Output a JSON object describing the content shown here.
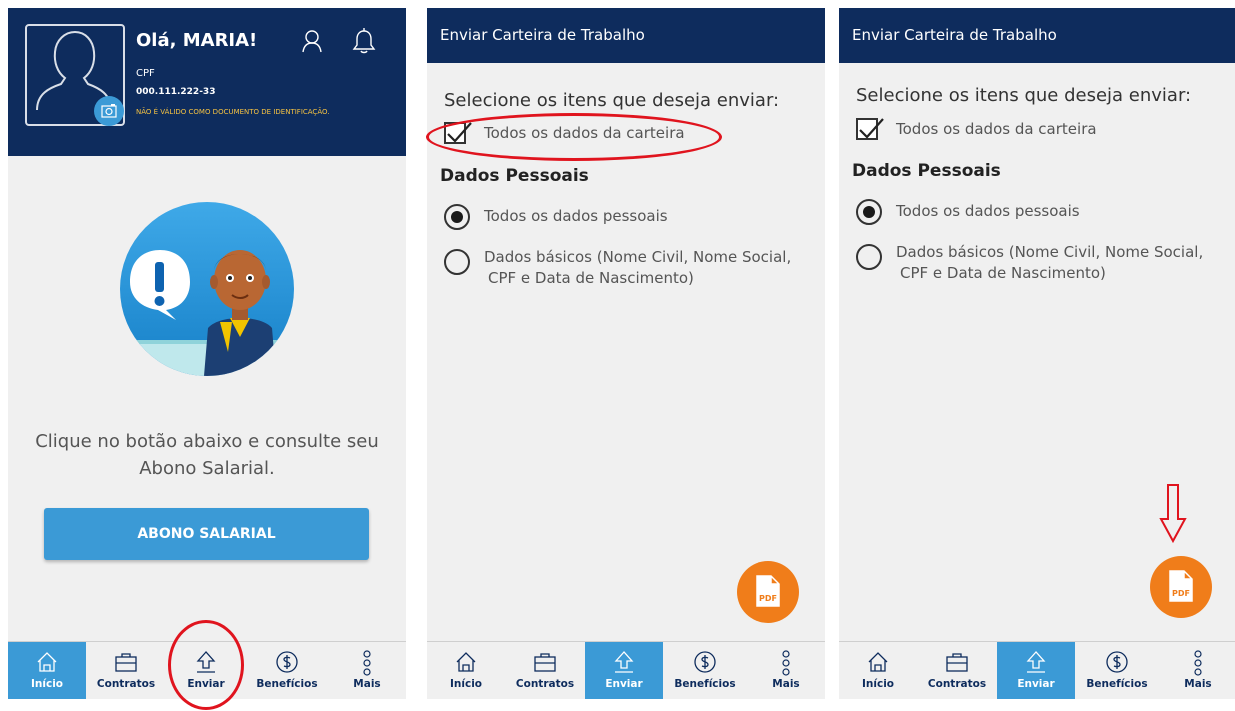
{
  "screen1": {
    "greeting": "Olá, MARIA!",
    "cpf_label": "CPF",
    "cpf_value": "000.111.222-33",
    "document_warning": "NÃO É VÁLIDO COMO DOCUMENTO DE IDENTIFICAÇÃO.",
    "info_text": "Clique no botão abaixo e consulte seu Abono Salarial.",
    "button_label": "ABONO SALARIAL",
    "active_tab": "Início"
  },
  "send_screen": {
    "title": "Enviar Carteira de Trabalho",
    "heading": "Selecione os itens que deseja enviar:",
    "checkbox_label": "Todos os dados da carteira",
    "checkbox_checked": true,
    "section_title": "Dados Pessoais",
    "radio_all_label": "Todos os dados pessoais",
    "radio_basic_line1": "Dados básicos (Nome Civil, Nome Social,",
    "radio_basic_line2": "CPF e Data de Nascimento)",
    "selected_radio": "Todos os dados pessoais",
    "fab_icon": "pdf-icon",
    "fab_text": "PDF",
    "active_tab": "Enviar"
  },
  "nav": {
    "items": [
      {
        "label": "Início",
        "icon": "home-icon"
      },
      {
        "label": "Contratos",
        "icon": "briefcase-icon"
      },
      {
        "label": "Enviar",
        "icon": "upload-arrow-icon"
      },
      {
        "label": "Benefícios",
        "icon": "dollar-circle-icon"
      },
      {
        "label": "Mais",
        "icon": "more-dots-icon"
      }
    ]
  },
  "colors": {
    "header_navy": "#0e2c5d",
    "accent_blue": "#3b9ad6",
    "fab_orange": "#f07d1a",
    "annotation_red": "#e0141e",
    "warning_yellow": "#f5c242"
  }
}
